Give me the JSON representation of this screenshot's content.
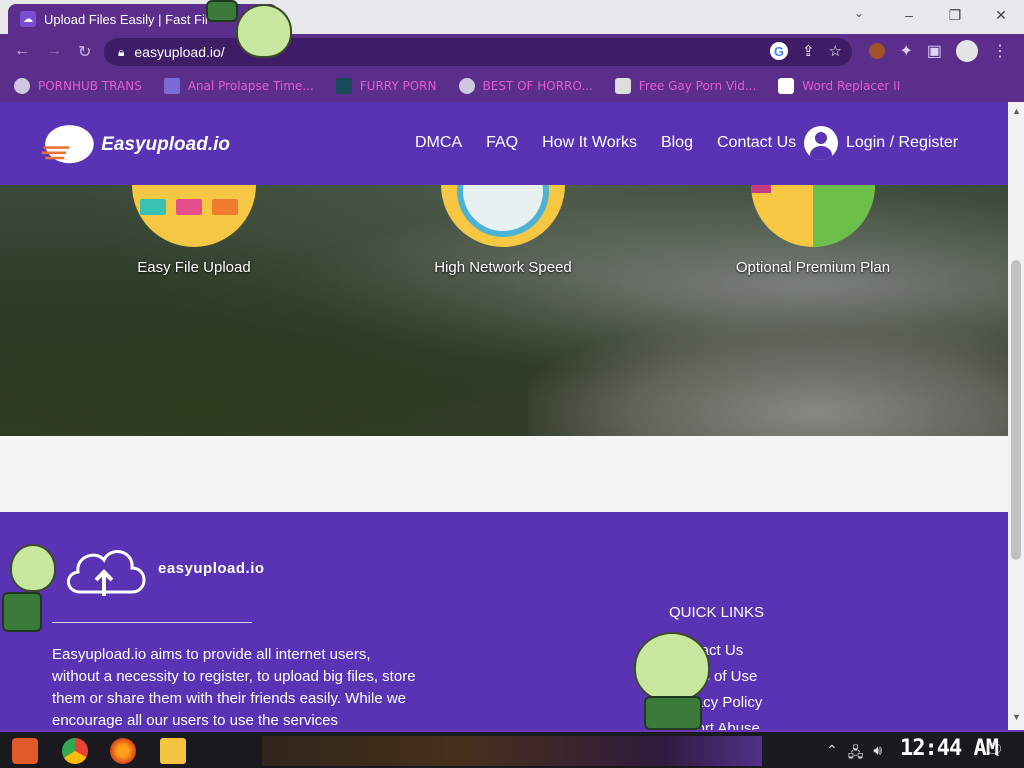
{
  "browser": {
    "tab_title": "Upload Files Easily | Fast Fil",
    "url": "easyupload.io/",
    "window_controls": [
      "‒",
      "❐",
      "✕"
    ]
  },
  "bookmarks": [
    {
      "label": "PORNHUB TRANS",
      "icon": "globe-icon"
    },
    {
      "label": "Anal Prolapse Time...",
      "icon": "bracket-icon"
    },
    {
      "label": "FURRY PORN",
      "icon": "a-icon"
    },
    {
      "label": "BEST OF HORRO...",
      "icon": "globe-icon"
    },
    {
      "label": "Free Gay Porn Vid...",
      "icon": "bag-icon"
    },
    {
      "label": "Word Replacer II",
      "icon": "wr-icon"
    }
  ],
  "site": {
    "logo_text": "Easyupload.io",
    "nav": [
      "DMCA",
      "FAQ",
      "How It Works",
      "Blog",
      "Contact Us"
    ],
    "login": "Login / Register",
    "brand_color": "#5a32b4"
  },
  "features": [
    {
      "label": "Easy File Upload"
    },
    {
      "label": "High Network Speed"
    },
    {
      "label": "Optional Premium Plan"
    }
  ],
  "footer": {
    "logo_text": "easyupload.io",
    "about": "Easyupload.io aims to provide all internet users, without a necessity to register, to upload big files, store them or share them with their friends easily. While we encourage all our users to use the services",
    "quick_links_title": "QUICK LINKS",
    "quick_links": [
      "Contact Us",
      "Terms of Use",
      "Privacy Policy",
      "Report Abuse"
    ]
  },
  "taskbar": {
    "time": "12:44 AM"
  }
}
